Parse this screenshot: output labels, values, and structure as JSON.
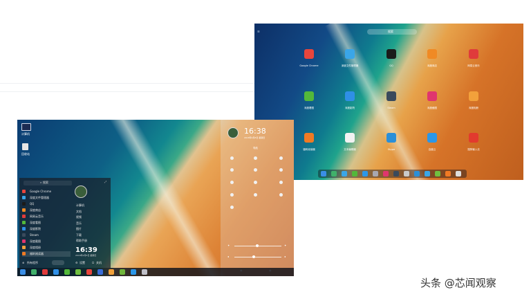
{
  "watermark": "头条 @芯闻观察",
  "launcher": {
    "search_label": "搜索",
    "apps": [
      {
        "label": "Google Chrome",
        "color": "#e8453c",
        "icon": "chrome-icon"
      },
      {
        "label": "深度文件管理器",
        "color": "#3aa6e8",
        "icon": "folder-icon"
      },
      {
        "label": "QQ",
        "color": "#1b1b1b",
        "icon": "qq-icon"
      },
      {
        "label": "深度商店",
        "color": "#f08a24",
        "icon": "store-icon"
      },
      {
        "label": "网易云音乐",
        "color": "#e03b3b",
        "icon": "music-icon"
      },
      {
        "label": "深度看图",
        "color": "#53b83a",
        "icon": "image-viewer-icon"
      },
      {
        "label": "深度影院",
        "color": "#2f8fe6",
        "icon": "movie-icon"
      },
      {
        "label": "Steam",
        "color": "#3a4a5c",
        "icon": "steam-icon"
      },
      {
        "label": "深度截图",
        "color": "#e0356e",
        "icon": "screenshot-icon"
      },
      {
        "label": "深度相册",
        "color": "#f2a13b",
        "icon": "album-icon"
      },
      {
        "label": "福昕阅读器",
        "color": "#f07a24",
        "icon": "pdf-icon"
      },
      {
        "label": "文本编辑器",
        "color": "#f2f2f2",
        "icon": "text-editor-icon"
      },
      {
        "label": "Skype",
        "color": "#2a8fd8",
        "icon": "skype-icon"
      },
      {
        "label": "百度云",
        "color": "#2b97e8",
        "icon": "cloud-icon"
      },
      {
        "label": "搜狗输入法",
        "color": "#e23a2e",
        "icon": "input-method-icon"
      }
    ]
  },
  "desktop": {
    "icons": [
      {
        "label": "计算机"
      },
      {
        "label": "回收站"
      }
    ]
  },
  "start_menu": {
    "search_label": "搜索",
    "items": [
      "Google Chrome",
      "深度文件管理器",
      "QQ",
      "深度商店",
      "网易云音乐",
      "深度看图",
      "深度影院",
      "Steam",
      "深度截图",
      "深度相册",
      "福昕阅读器"
    ],
    "item_colors": [
      "#e8453c",
      "#3aa6e8",
      "#1b1b1b",
      "#f08a24",
      "#e03b3b",
      "#53b83a",
      "#2f8fe6",
      "#3a4a5c",
      "#e0356e",
      "#f2a13b",
      "#f07a24"
    ],
    "all_apps_label": "所有程序",
    "right_links": [
      "计算机",
      "文档",
      "视频",
      "音乐",
      "图片",
      "下载",
      "帮助手册"
    ],
    "clock": "16:39",
    "date": "2018年4月8日 星期日",
    "settings_label": "设置",
    "power_label": "关机"
  },
  "control_center": {
    "time": "16:38",
    "date": "2018年4月8日 星期日",
    "section_label": "导航"
  }
}
